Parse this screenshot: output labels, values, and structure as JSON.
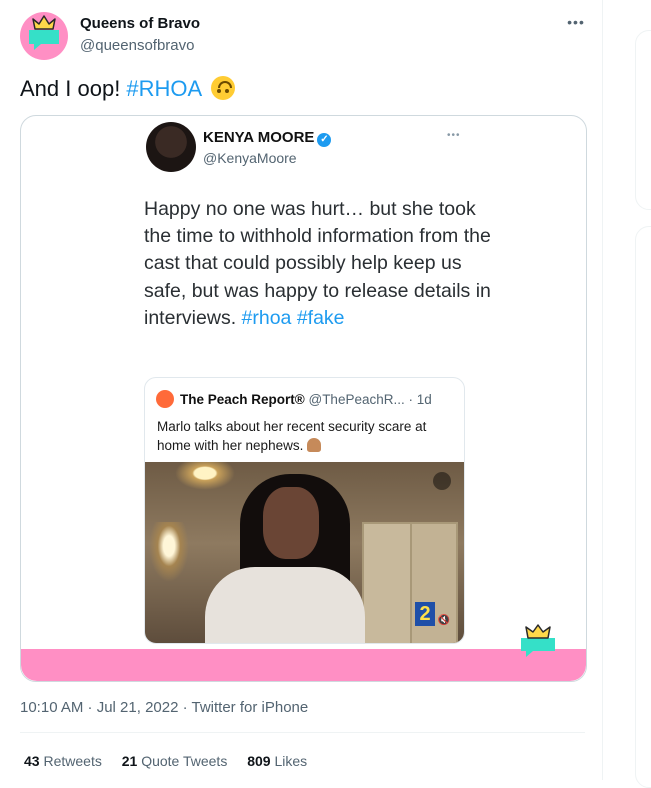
{
  "tweet": {
    "author_name": "Queens of Bravo",
    "author_handle": "@queensofbravo",
    "text_prefix": "And I oop! ",
    "hashtag": "#RHOA",
    "emoji": "upside-down-face-emoji",
    "timestamp": "10:10 AM · Jul 21, 2022 · Twitter for iPhone",
    "stats": {
      "retweets_count": "43",
      "retweets_label": "Retweets",
      "quotes_count": "21",
      "quotes_label": "Quote Tweets",
      "likes_count": "809",
      "likes_label": "Likes"
    }
  },
  "embedded": {
    "name": "KENYA MOORE",
    "handle": "@KenyaMoore",
    "text": "Happy no one was hurt… but she took the time to withhold information from the cast that could possibly help keep us safe, but was happy to release details in interviews. ",
    "hashtags": "#rhoa #fake",
    "quote": {
      "name": "The Peach Report®",
      "meta": " @ThePeachR... · 1d",
      "text": "Marlo talks about her recent security scare at home with her nephews. ",
      "video_logo": "2"
    }
  },
  "colors": {
    "accent": "#1d9bf0",
    "pink": "#ff8fc4",
    "teal": "#35e0c8",
    "crown": "#ffd84a"
  }
}
